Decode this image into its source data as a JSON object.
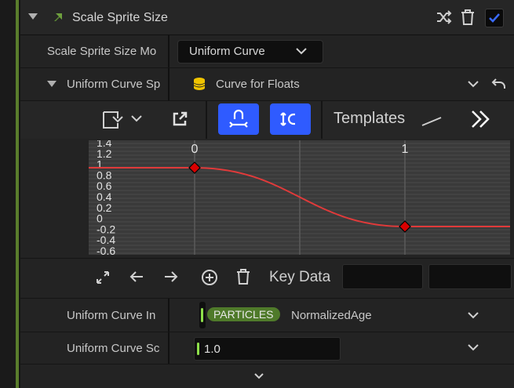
{
  "header": {
    "title": "Scale Sprite Size",
    "shuffle_icon": "shuffle-icon",
    "delete_icon": "trash-icon",
    "enabled": true
  },
  "mode_row": {
    "label": "Scale Sprite Size Mo",
    "value": "Uniform Curve"
  },
  "curve_row": {
    "label": "Uniform Curve Sp",
    "value": "Curve for Floats"
  },
  "toolbar": {
    "templates_label": "Templates"
  },
  "graph": {
    "y_ticks": [
      "1.4",
      "1.2",
      "1",
      "0.8",
      "0.6",
      "0.4",
      "0.2",
      "0",
      "-0.2",
      "-0.4",
      "-0.6"
    ],
    "x_ticks": [
      "0",
      "1"
    ],
    "keys": [
      {
        "time": 0,
        "value": 1
      },
      {
        "time": 1,
        "value": 0
      }
    ],
    "curve_color": "#e03a3a"
  },
  "key_row": {
    "label": "Key Data",
    "time_value": "",
    "value_value": ""
  },
  "input_row": {
    "label": "Uniform Curve In",
    "badge": "PARTICLES",
    "value": "NormalizedAge"
  },
  "scale_row": {
    "label": "Uniform Curve Sc",
    "value": "1.0"
  },
  "colors": {
    "accent_blue": "#2f5bff",
    "green": "#4f7a2a",
    "key_red": "#d90000"
  }
}
